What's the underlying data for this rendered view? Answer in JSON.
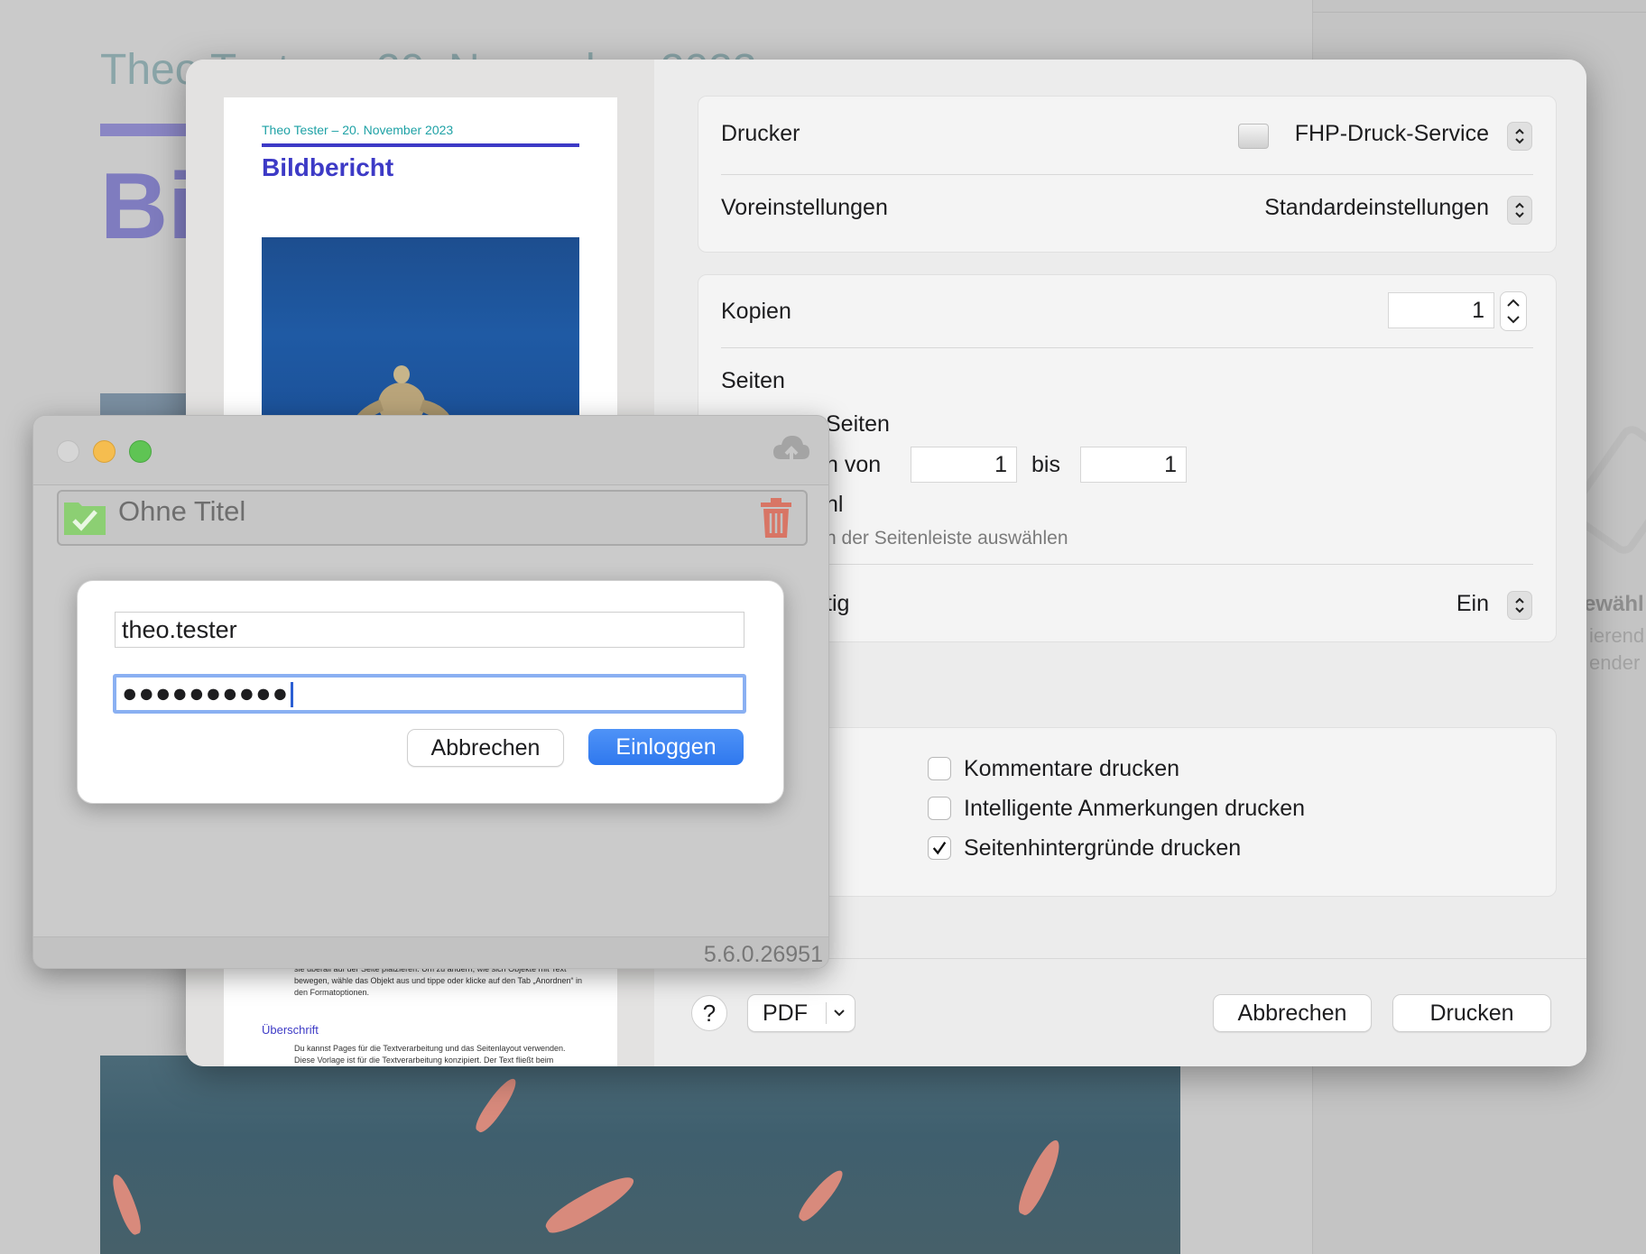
{
  "background_document": {
    "subtitle": "Theo Tester – 20. November 2023",
    "title": "Bildbericht",
    "sidebar_ghost": [
      "ewähl",
      "ierend",
      "ender"
    ]
  },
  "print_dialog": {
    "preview": {
      "subtitle": "Theo Tester – 20. November 2023",
      "title": "Bildbericht",
      "body_fragment": "sie überall auf der Seite platzieren. Um zu ändern, wie sich Objekte mit Text bewegen, wähle das Objekt aus und tippe oder klicke auf den Tab „Anordnen“ in den Formatoptionen.",
      "heading": "Überschrift",
      "body_text": "Du kannst Pages für die Textverarbeitung und das Seitenlayout verwenden. Diese Vorlage ist für die Textverarbeitung konzipiert. Der Text fließt beim"
    },
    "printer_label": "Drucker",
    "printer_value": "FHP-Druck-Service",
    "presets_label": "Voreinstellungen",
    "presets_value": "Standardeinstellungen",
    "copies_label": "Kopien",
    "copies_value": "1",
    "pages_label": "Seiten",
    "pages_all_partial": "Seiten",
    "pages_range_partial": "n von",
    "range_from": "1",
    "range_to_label": "bis",
    "range_to": "1",
    "pages_selection_partial": "hl",
    "pages_selection_hint_partial": "n der Seitenleiste auswählen",
    "duplex_partial": "tig",
    "duplex_value": "Ein",
    "options": [
      {
        "label": "Kommentare drucken",
        "checked": false
      },
      {
        "label": "Intelligente Anmerkungen drucken",
        "checked": false
      },
      {
        "label": "Seitenhintergründe drucken",
        "checked": true
      }
    ],
    "help_label": "?",
    "pdf_label": "PDF",
    "cancel_label": "Abbrechen",
    "print_label": "Drucken"
  },
  "app_window": {
    "folder_title": "Ohne Titel",
    "version": "5.6.0.26951",
    "login": {
      "username": "theo.tester",
      "password_masked": "●●●●●●●●●●",
      "cancel_label": "Abbrechen",
      "login_label": "Einloggen"
    }
  },
  "colors": {
    "accent": "#2f78ee",
    "doc_title": "#3d3ac6",
    "doc_subtitle": "#1fa2a6",
    "traffic_close": "#d6d6d6",
    "traffic_min": "#f5bd4f",
    "traffic_max": "#5fc454"
  }
}
